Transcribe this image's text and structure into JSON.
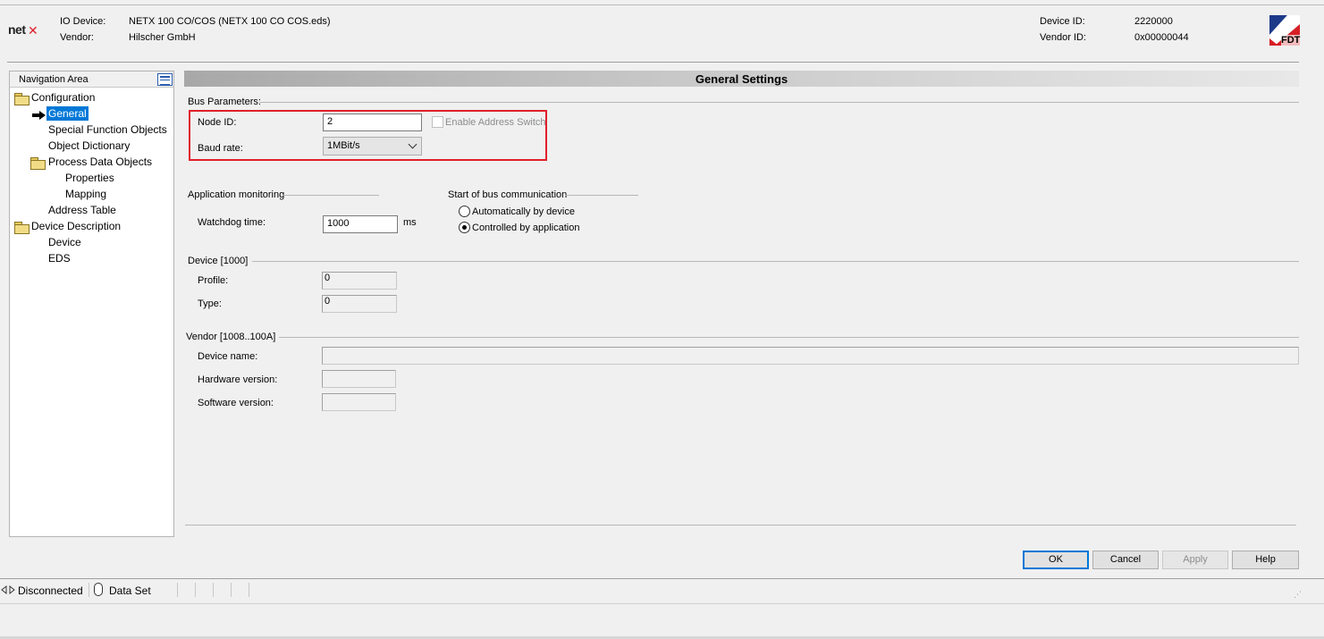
{
  "header": {
    "io_device_label": "IO Device:",
    "io_device_value": "NETX 100 CO/COS (NETX 100 CO COS.eds)",
    "vendor_label": "Vendor:",
    "vendor_value": "Hilscher GmbH",
    "device_id_label": "Device ID:",
    "device_id_value": "2220000",
    "vendor_id_label": "Vendor ID:",
    "vendor_id_value": "0x00000044",
    "logo_left_text": "net",
    "logo_right_text": "FDT"
  },
  "nav": {
    "title": "Navigation Area",
    "items": [
      {
        "label": "Configuration",
        "icon": "folder-icon"
      },
      {
        "label": "General",
        "icon": "arrow-right-icon",
        "selected": true
      },
      {
        "label": "Special Function Objects"
      },
      {
        "label": "Object Dictionary"
      },
      {
        "label": "Process Data Objects",
        "icon": "folder-icon"
      },
      {
        "label": "Properties"
      },
      {
        "label": "Mapping"
      },
      {
        "label": "Address Table"
      },
      {
        "label": "Device Description",
        "icon": "folder-icon"
      },
      {
        "label": "Device"
      },
      {
        "label": "EDS"
      }
    ]
  },
  "main": {
    "title": "General Settings",
    "bus_parameters": {
      "group_label": "Bus Parameters:",
      "node_id_label": "Node ID:",
      "node_id_value": "2",
      "enable_address_switch_label": "Enable Address Switch",
      "enable_address_switch_checked": false,
      "baud_rate_label": "Baud rate:",
      "baud_rate_value": "1MBit/s"
    },
    "app_monitoring": {
      "group_label": "Application monitoring",
      "watchdog_label": "Watchdog time:",
      "watchdog_value": "1000",
      "watchdog_unit": "ms"
    },
    "bus_comm": {
      "group_label": "Start of bus communication",
      "option_auto": "Automatically by device",
      "option_app": "Controlled by application",
      "selected": "Controlled by application"
    },
    "device": {
      "group_label": "Device [1000]",
      "profile_label": "Profile:",
      "profile_value": "0",
      "type_label": "Type:",
      "type_value": "0"
    },
    "vendor": {
      "group_label": "Vendor [1008..100A]",
      "device_name_label": "Device name:",
      "device_name_value": "",
      "hw_version_label": "Hardware version:",
      "hw_version_value": "",
      "sw_version_label": "Software version:",
      "sw_version_value": ""
    }
  },
  "buttons": {
    "ok": "OK",
    "cancel": "Cancel",
    "apply": "Apply",
    "help": "Help"
  },
  "statusbar": {
    "connection": "Disconnected",
    "dataset": "Data Set"
  },
  "colors": {
    "highlight_box": "#e0202a",
    "selection": "#0078d7"
  }
}
